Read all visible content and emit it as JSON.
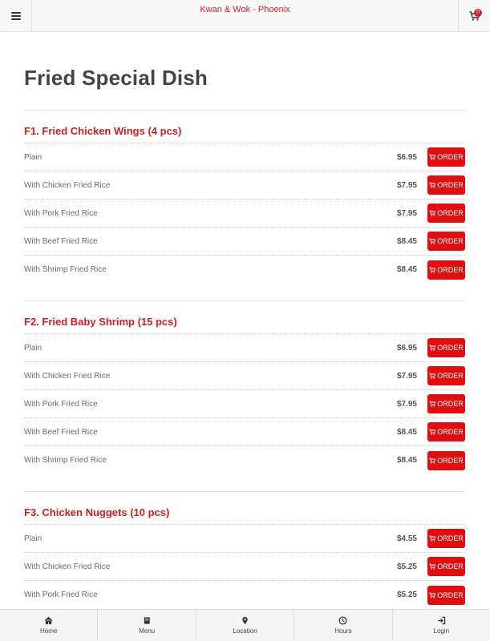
{
  "header": {
    "title": "Kwan & Wok - Phoenix",
    "menu_icon": "hamburger-icon",
    "cart_icon": "cart-icon",
    "cart_count": "0"
  },
  "page": {
    "title": "Fried Special Dish"
  },
  "order_label": "ORDER",
  "sections": [
    {
      "heading": "F1. Fried Chicken Wings (4 pcs)",
      "items": [
        {
          "name": "Plain",
          "price": "$6.95"
        },
        {
          "name": "With Chicken Fried Rice",
          "price": "$7.95"
        },
        {
          "name": "With Pork Fried Rice",
          "price": "$7.95"
        },
        {
          "name": "With Beef Fried Rice",
          "price": "$8.45"
        },
        {
          "name": "With Shrimp Fried Rice",
          "price": "$8.45"
        }
      ]
    },
    {
      "heading": "F2. Fried Baby Shrimp (15 pcs)",
      "items": [
        {
          "name": "Plain",
          "price": "$6.95"
        },
        {
          "name": "With Chicken Fried Rice",
          "price": "$7.95"
        },
        {
          "name": "With Pork Fried Rice",
          "price": "$7.95"
        },
        {
          "name": "With Beef Fried Rice",
          "price": "$8.45"
        },
        {
          "name": "With Shrimp Fried Rice",
          "price": "$8.45"
        }
      ]
    },
    {
      "heading": "F3. Chicken Nuggets (10 pcs)",
      "items": [
        {
          "name": "Plain",
          "price": "$4.55"
        },
        {
          "name": "With Chicken Fried Rice",
          "price": "$5.25"
        },
        {
          "name": "With Pork Fried Rice",
          "price": "$5.25"
        }
      ]
    }
  ],
  "bottom_nav": [
    {
      "label": "Home",
      "icon": "home-icon"
    },
    {
      "label": "Menu",
      "icon": "book-icon"
    },
    {
      "label": "Location",
      "icon": "map-pin-icon"
    },
    {
      "label": "Hours",
      "icon": "clock-icon"
    },
    {
      "label": "Login",
      "icon": "login-icon"
    }
  ],
  "colors": {
    "brand_red": "#d61f26",
    "order_button": "#e00e0e"
  }
}
